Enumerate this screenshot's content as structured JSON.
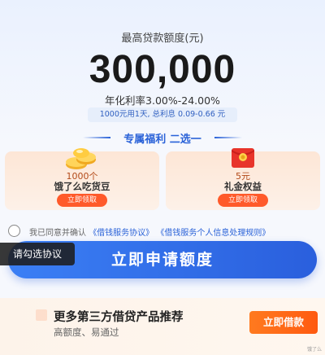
{
  "limit": {
    "label": "最高贷款额度(元)",
    "amount": "300,000",
    "rate": "年化利率3.00%-24.00%",
    "interest_note": "1000元用1天, 总利息 0.09-0.66 元"
  },
  "welfare": {
    "title": "专属福利 二选一",
    "cards": [
      {
        "title": "1000个",
        "subtitle": "饿了么吃货豆",
        "button": "立即领取",
        "icon": "coin-stack-icon"
      },
      {
        "title": "5元",
        "subtitle": "礼金权益",
        "button": "立即领取",
        "icon": "red-packet-icon"
      }
    ]
  },
  "agreement": {
    "prefix": "我已同意并确认",
    "link1": "《借钱服务协议》",
    "link2": "《借钱服务个人信息处理规则》"
  },
  "apply_button": "立即申请额度",
  "tooltip": "请勾选协议",
  "promo": {
    "title": "更多第三方借贷产品推荐",
    "subtitle": "高额度、易通过",
    "button": "立即借款"
  },
  "watermark": "饿了么",
  "colors": {
    "accent": "#2a62d8",
    "orange": "#ff5a2a",
    "card_bg": "#fde6d6"
  }
}
